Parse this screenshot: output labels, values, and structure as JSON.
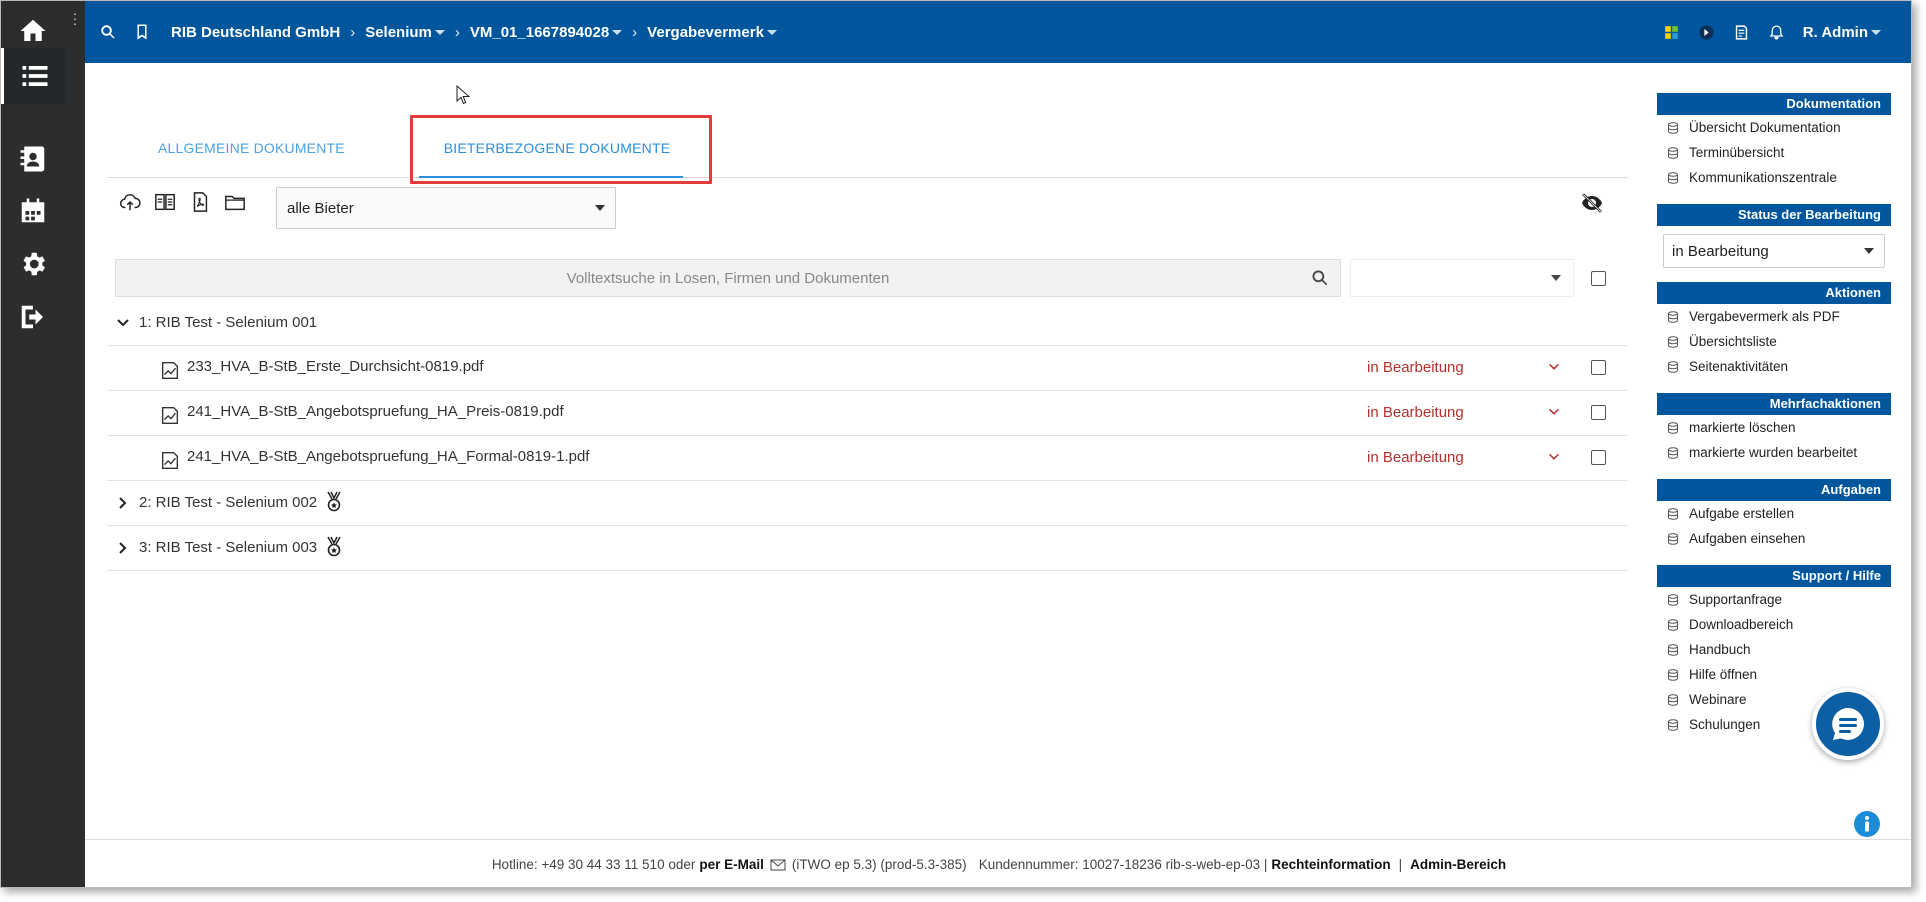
{
  "header": {
    "breadcrumbs": [
      {
        "label": "RIB Deutschland GmbH",
        "dropdown": false
      },
      {
        "label": "Selenium",
        "dropdown": true
      },
      {
        "label": "VM_01_1667894028",
        "dropdown": true
      },
      {
        "label": "Vergabevermerk",
        "dropdown": true
      }
    ],
    "user": "R. Admin"
  },
  "tabs": {
    "general": "ALLGEMEINE DOKUMENTE",
    "bidder": "BIETERBEZOGENE DOKUMENTE"
  },
  "toolbar": {
    "bidder_filter": "alle Bieter"
  },
  "search": {
    "placeholder": "Volltextsuche in Losen, Firmen und Dokumenten"
  },
  "groups": [
    {
      "label": "1: RIB Test - Selenium 001",
      "expanded": true,
      "documents": [
        {
          "name": "233_HVA_B-StB_Erste_Durchsicht-0819.pdf",
          "status": "in Bearbeitung"
        },
        {
          "name": "241_HVA_B-StB_Angebotspruefung_HA_Preis-0819.pdf",
          "status": "in Bearbeitung"
        },
        {
          "name": "241_HVA_B-StB_Angebotspruefung_HA_Formal-0819-1.pdf",
          "status": "in Bearbeitung"
        }
      ]
    },
    {
      "label": "2: RIB Test - Selenium 002",
      "expanded": false
    },
    {
      "label": "3: RIB Test - Selenium 003",
      "expanded": false
    }
  ],
  "sidebar": {
    "documentation": {
      "title": "Dokumentation",
      "items": [
        "Übersicht Dokumentation",
        "Terminübersicht",
        "Kommunikationszentrale"
      ]
    },
    "status": {
      "title": "Status der Bearbeitung",
      "value": "in Bearbeitung"
    },
    "actions": {
      "title": "Aktionen",
      "items": [
        "Vergabevermerk als PDF",
        "Übersichtsliste",
        "Seitenaktivitäten"
      ]
    },
    "multi": {
      "title": "Mehrfachaktionen",
      "items": [
        "markierte löschen",
        "markierte wurden bearbeitet"
      ]
    },
    "tasks": {
      "title": "Aufgaben",
      "items": [
        "Aufgabe erstellen",
        "Aufgaben einsehen"
      ]
    },
    "support": {
      "title": "Support / Hilfe",
      "items": [
        "Supportanfrage",
        "Downloadbereich",
        "Handbuch",
        "Hilfe öffnen",
        "Webinare",
        "Schulungen"
      ]
    }
  },
  "footer": {
    "hotline": "Hotline: +49 30 44 33 11 510 oder",
    "email_link": "per E-Mail",
    "version": "(iTWO ep 5.3) (prod-5.3-385)",
    "customer": "Kundennummer: 10027-18236 rib-s-web-ep-03 |",
    "legal_link": "Rechteinformation",
    "separator": "|",
    "admin_link": "Admin-Bereich"
  },
  "colors": {
    "brand_blue": "#00569c",
    "rail": "#2b2d2f",
    "tab_active": "#2b8fd8",
    "status_red": "#b3312d",
    "highlight_red": "#e23c3c"
  }
}
